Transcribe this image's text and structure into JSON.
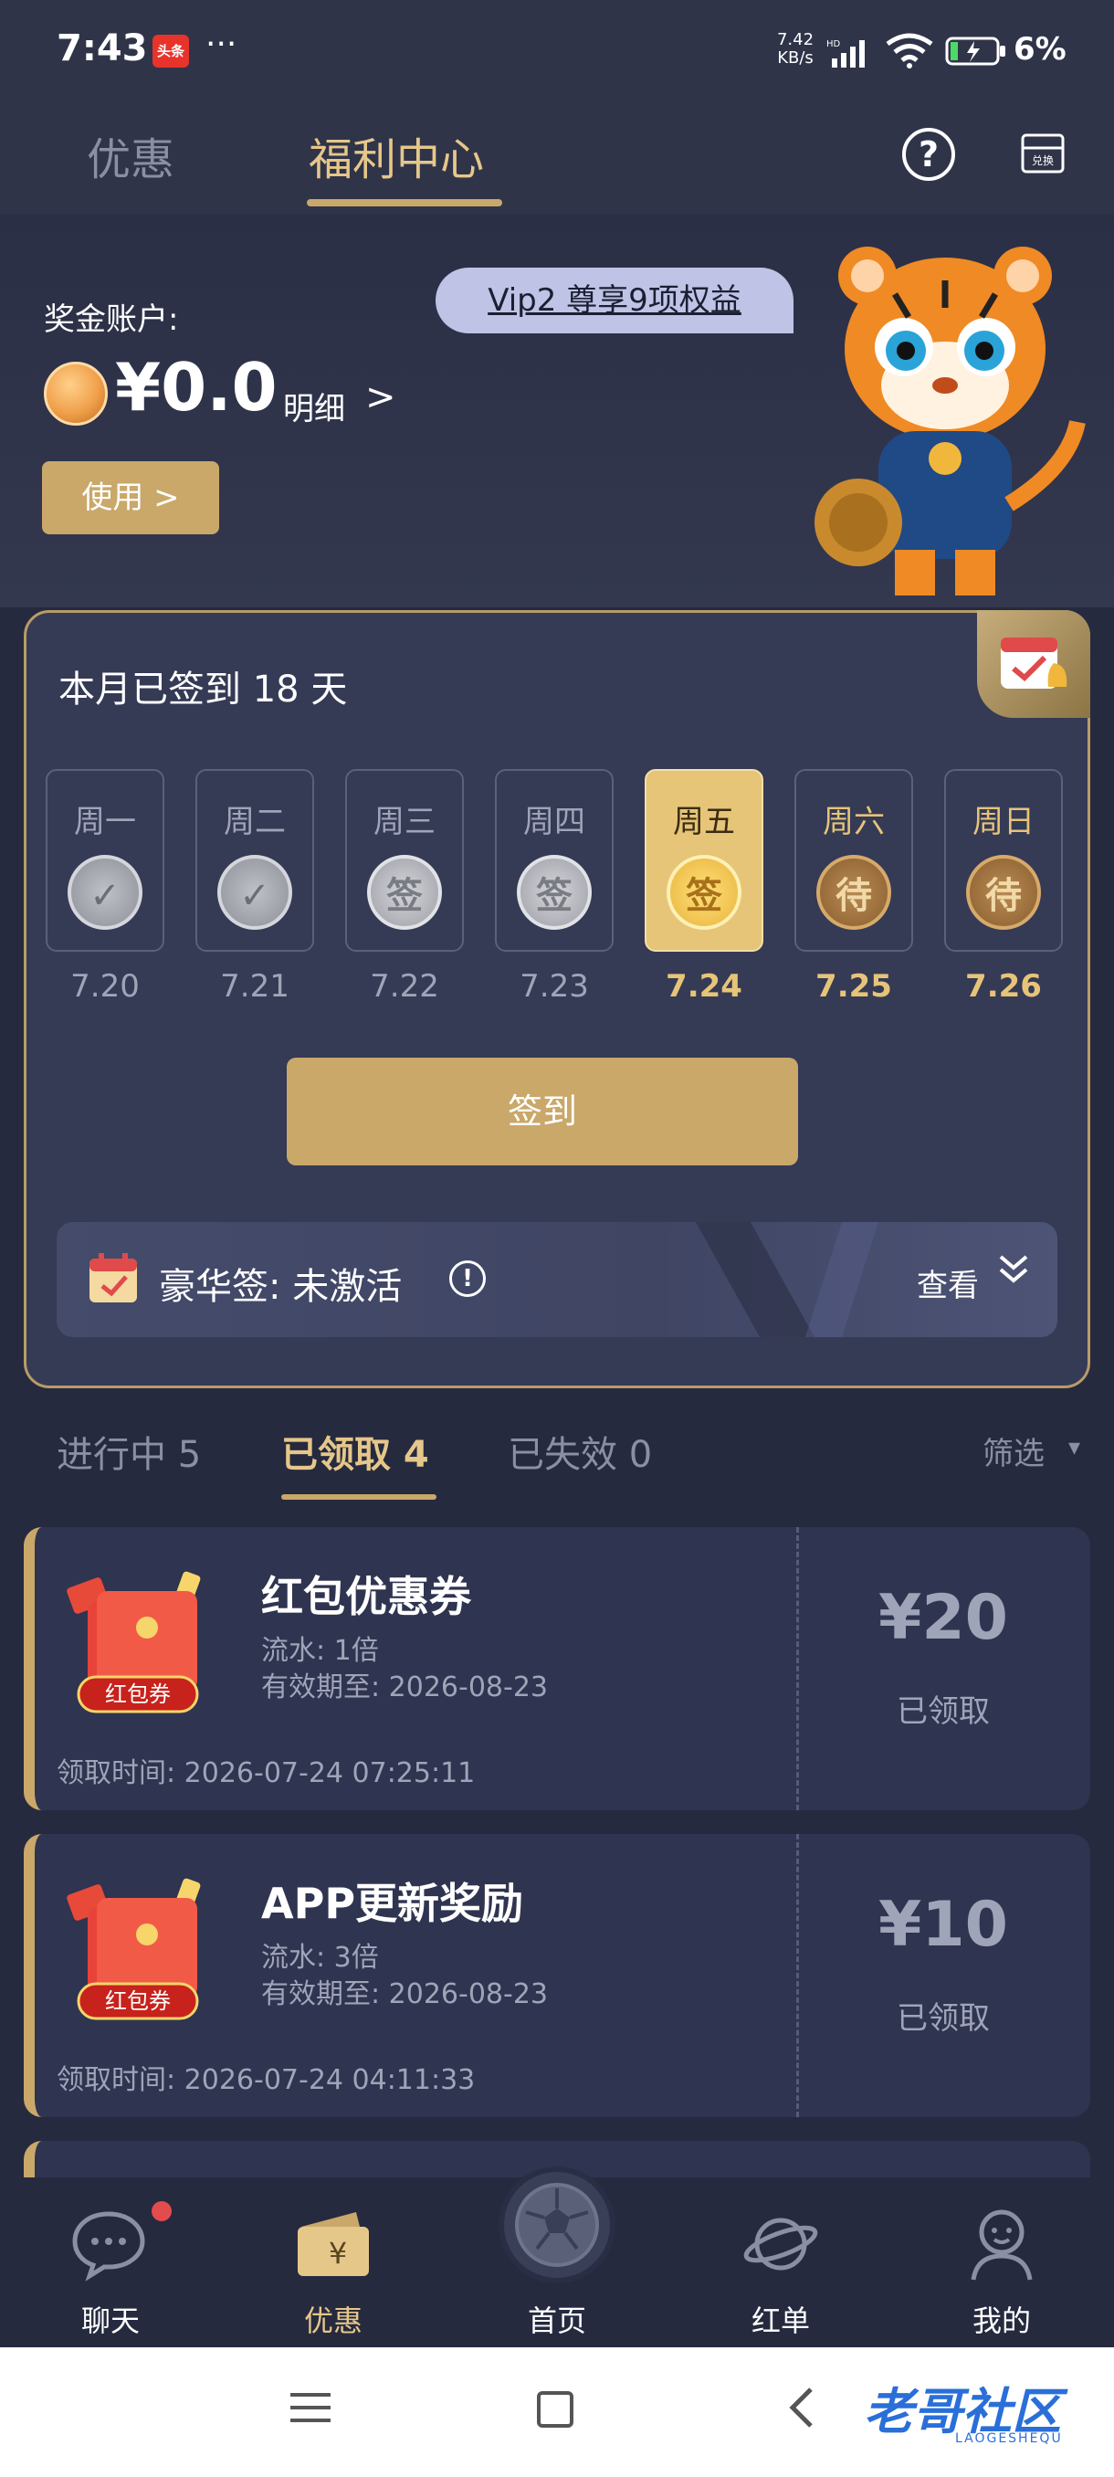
{
  "status_bar": {
    "time": "7:43",
    "app_badge": "头条",
    "more": "···",
    "net_speed_value": "7.42",
    "net_speed_unit": "KB/s",
    "net_type": "HD",
    "battery_pct": "6%"
  },
  "top_nav": {
    "tabs": [
      {
        "label": "优惠",
        "active": false
      },
      {
        "label": "福利中心",
        "active": true
      }
    ],
    "help_label": "?",
    "exchange_label": "兑换"
  },
  "account": {
    "label": "奖金账户:",
    "vip_text": "Vip2 尊享9项权益",
    "balance": "¥0.0",
    "detail_label": "明细",
    "detail_arrow": ">",
    "use_button": "使用 >"
  },
  "signin": {
    "summary": "本月已签到 18 天",
    "days": [
      {
        "weekday": "周一",
        "date": "7.20",
        "state": "checked",
        "badge": "✓"
      },
      {
        "weekday": "周二",
        "date": "7.21",
        "state": "checked",
        "badge": "✓"
      },
      {
        "weekday": "周三",
        "date": "7.22",
        "state": "signed",
        "badge": "签"
      },
      {
        "weekday": "周四",
        "date": "7.23",
        "state": "signed",
        "badge": "签"
      },
      {
        "weekday": "周五",
        "date": "7.24",
        "state": "today",
        "badge": "签"
      },
      {
        "weekday": "周六",
        "date": "7.25",
        "state": "pending",
        "badge": "待"
      },
      {
        "weekday": "周日",
        "date": "7.26",
        "state": "pending",
        "badge": "待"
      }
    ],
    "sign_button": "签到",
    "luxury_label": "豪华签: 未激活",
    "info_icon": "!",
    "view_label": "查看"
  },
  "filters": {
    "tabs": [
      {
        "label": "进行中 5",
        "active": false
      },
      {
        "label": "已领取 4",
        "active": true
      },
      {
        "label": "已失效 0",
        "active": false
      }
    ],
    "filter_label": "筛选",
    "filter_caret": "▾"
  },
  "coupons": [
    {
      "title": "红包优惠券",
      "envelope_label": "红包券",
      "turnover": "流水: 1倍",
      "valid_until": "有效期至: 2026-08-23",
      "claim_time": "领取时间: 2026-07-24 07:25:11",
      "amount": "¥20",
      "status": "已领取"
    },
    {
      "title": "APP更新奖励",
      "envelope_label": "红包券",
      "turnover": "流水: 3倍",
      "valid_until": "有效期至: 2026-08-23",
      "claim_time": "领取时间: 2026-07-24 04:11:33",
      "amount": "¥10",
      "status": "已领取"
    }
  ],
  "bottom_nav": {
    "items": [
      {
        "label": "聊天",
        "icon": "chat-icon",
        "active": false
      },
      {
        "label": "优惠",
        "icon": "coupon-wallet-icon",
        "active": true
      },
      {
        "label": "首页",
        "icon": "football-icon",
        "active": false
      },
      {
        "label": "红单",
        "icon": "planet-icon",
        "active": false
      },
      {
        "label": "我的",
        "icon": "user-icon",
        "active": false
      }
    ]
  },
  "watermark": {
    "text": "老哥社区",
    "sub": "LAOGESHEQU"
  },
  "colors": {
    "background": "#262a3f",
    "gold": "#c9a86a",
    "gold_text": "#e6c78a",
    "muted": "#8a8fa4"
  }
}
